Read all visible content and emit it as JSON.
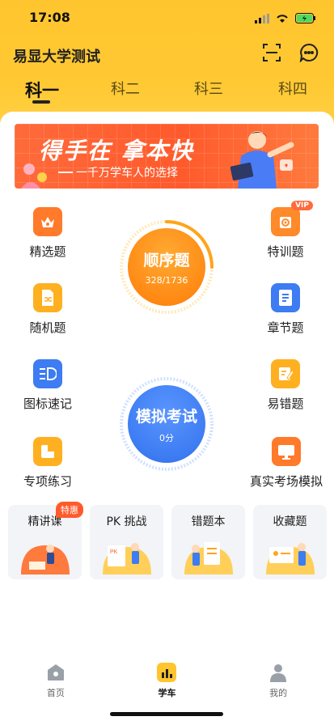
{
  "status": {
    "time": "17:08"
  },
  "app": {
    "title": "易显大学测试"
  },
  "tabs": [
    {
      "label": "科一",
      "active": true
    },
    {
      "label": "科二",
      "active": false
    },
    {
      "label": "科三",
      "active": false
    },
    {
      "label": "科四",
      "active": false
    }
  ],
  "banner": {
    "title": "得手在 拿本快",
    "subtitle": "一千万学车人的选择"
  },
  "features": {
    "jingxuan": {
      "label": "精选题",
      "icon": "crown-icon"
    },
    "texun": {
      "label": "特训题",
      "icon": "target-icon",
      "badge": "VIP"
    },
    "suiji": {
      "label": "随机题",
      "icon": "shuffle-icon"
    },
    "zhangjie": {
      "label": "章节题",
      "icon": "document-icon"
    },
    "tubiao": {
      "label": "图标速记",
      "icon": "list-icon"
    },
    "yicuo": {
      "label": "易错题",
      "icon": "edit-icon"
    },
    "zhuanxiang": {
      "label": "专项练习",
      "icon": "grid-icon"
    },
    "zhenshi": {
      "label": "真实考场模拟",
      "icon": "monitor-icon"
    }
  },
  "sequence": {
    "title": "顺序题",
    "progress": "328/1736"
  },
  "exam": {
    "title": "模拟考试",
    "score": "0分"
  },
  "cards": [
    {
      "label": "精讲课",
      "badge": "特惠"
    },
    {
      "label": "PK 挑战"
    },
    {
      "label": "错题本"
    },
    {
      "label": "收藏题"
    }
  ],
  "nav": [
    {
      "label": "首页",
      "icon": "home-icon"
    },
    {
      "label": "学车",
      "icon": "chart-icon"
    },
    {
      "label": "我的",
      "icon": "user-icon"
    }
  ],
  "colors": {
    "brand_yellow": "#ffc52e",
    "orange": "#ff7a2a",
    "blue": "#3d7cf2"
  }
}
